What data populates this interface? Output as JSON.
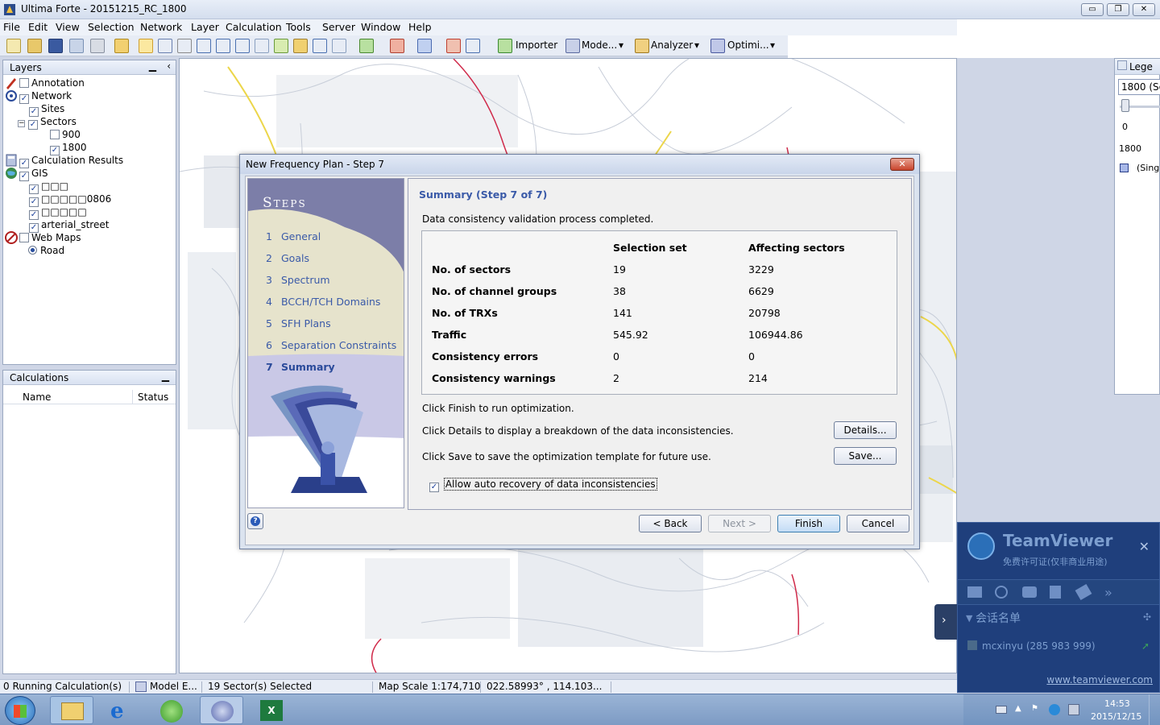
{
  "window": {
    "title": "Ultima Forte - 20151215_RC_1800",
    "buttons": {
      "minimize": "▭",
      "restore": "❐",
      "close": "✕"
    }
  },
  "menu": [
    "File",
    "Edit",
    "View",
    "Selection",
    "Network",
    "Layer",
    "Calculation",
    "Tools",
    "Server",
    "Window",
    "Help"
  ],
  "toolbar": {
    "importer": "Importer",
    "model": "Mode...",
    "analyzer": "Analyzer",
    "optimizer": "Optimi..."
  },
  "layers_panel": {
    "title": "Layers",
    "items": [
      {
        "label": "Annotation",
        "checked": false
      },
      {
        "label": "Network",
        "checked": true
      },
      {
        "label": "Sites",
        "checked": true
      },
      {
        "label": "Sectors",
        "checked": true
      },
      {
        "label": "900",
        "checked": false
      },
      {
        "label": "1800",
        "checked": true
      },
      {
        "label": "Calculation Results",
        "checked": true
      },
      {
        "label": "GIS",
        "checked": true
      },
      {
        "label": "□□□",
        "checked": true
      },
      {
        "label": "□□□□□0806",
        "checked": true
      },
      {
        "label": "□□□□□",
        "checked": true
      },
      {
        "label": "arterial_street",
        "checked": true
      },
      {
        "label": "Web Maps",
        "checked": false
      },
      {
        "label": "Road",
        "checked": true
      }
    ]
  },
  "calculations_panel": {
    "title": "Calculations",
    "columns": [
      "Name",
      "Status"
    ]
  },
  "legend": {
    "title": "Lege",
    "select_value": "1800 (Se",
    "slider_value": "0",
    "layer_label": "1800",
    "item_label": "(Single"
  },
  "status_bar": {
    "running": "0 Running Calculation(s)",
    "model": "Model E...",
    "selected": "19 Sector(s) Selected",
    "scale": "Map Scale 1:174,710",
    "coords": "022.58993° , 114.103..."
  },
  "taskbar": {
    "time": "14:53",
    "date": "2015/12/15"
  },
  "dialog": {
    "title": "New Frequency Plan - Step 7",
    "steps_title": "Steps",
    "steps": [
      {
        "num": "1",
        "label": "General"
      },
      {
        "num": "2",
        "label": "Goals"
      },
      {
        "num": "3",
        "label": "Spectrum"
      },
      {
        "num": "4",
        "label": "BCCH/TCH Domains"
      },
      {
        "num": "5",
        "label": "SFH Plans"
      },
      {
        "num": "6",
        "label": "Separation Constraints"
      },
      {
        "num": "7",
        "label": "Summary"
      }
    ],
    "summary_title": "Summary (Step 7 of 7)",
    "validation_text": "Data consistency validation process completed.",
    "table": {
      "col_selection": "Selection set",
      "col_affecting": "Affecting sectors",
      "rows": [
        {
          "label": "No. of sectors",
          "selection": "19",
          "affecting": "3229"
        },
        {
          "label": "No. of channel groups",
          "selection": "38",
          "affecting": "6629"
        },
        {
          "label": "No. of TRXs",
          "selection": "141",
          "affecting": "20798"
        },
        {
          "label": "Traffic",
          "selection": "545.92",
          "affecting": "106944.86"
        },
        {
          "label": "Consistency errors",
          "selection": "0",
          "affecting": "0"
        },
        {
          "label": "Consistency warnings",
          "selection": "2",
          "affecting": "214"
        }
      ]
    },
    "finish_text": "Click Finish to run optimization.",
    "details_text": "Click Details to display a breakdown of the data inconsistencies.",
    "save_text": "Click Save to save the optimization template for future use.",
    "details_button": "Details...",
    "save_button": "Save...",
    "auto_recovery_label": "Allow auto recovery of data inconsistencies",
    "auto_recovery_checked": true,
    "back_button": "< Back",
    "next_button": "Next >",
    "finish_button": "Finish",
    "cancel_button": "Cancel"
  },
  "teamviewer": {
    "name": "TeamViewer",
    "license": "免费许可证(仅非商业用途)",
    "session_list": "会话名单",
    "contact": "mcxinyu (285 983 999)",
    "link": "www.teamviewer.com"
  }
}
